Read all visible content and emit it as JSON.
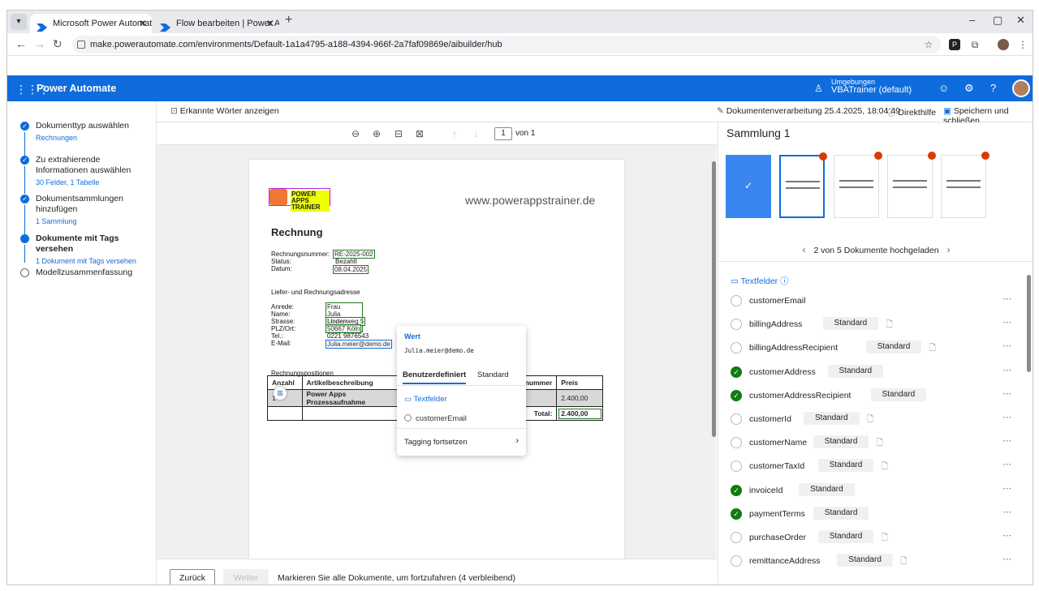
{
  "browser": {
    "tabs": [
      {
        "label": "Microsoft Power Automate | KI"
      },
      {
        "label": "Flow bearbeiten | Power Automate"
      }
    ],
    "new_tab": "+",
    "url": "make.powerautomate.com/environments/Default-1a1a4795-a188-4394-966f-2a7faf09869e/aibuilder/hub",
    "icons": [
      "chevron-down-icon",
      "back-icon",
      "forward-icon",
      "reload-icon",
      "star-icon",
      "extension-icon",
      "profile-icon",
      "menu-icon"
    ]
  },
  "app": {
    "name": "Power Automate",
    "env_label": "Umgebungen",
    "env_name": "VBATrainer (default)",
    "header_icons": [
      "waffle-icon",
      "environment-icon",
      "smiley-icon",
      "settings-icon",
      "help-icon"
    ],
    "brand_color": "#0f6cdc"
  },
  "steps": [
    {
      "title": "Dokumenttyp auswählen",
      "sub": "Rechnungen",
      "state": "done"
    },
    {
      "title": "Zu extrahierende Informationen auswählen",
      "sub": "30 Felder, 1 Tabelle",
      "state": "done"
    },
    {
      "title": "Dokumentsammlungen hinzufügen",
      "sub": "1 Sammlung",
      "state": "done"
    },
    {
      "title": "Dokumente mit Tags versehen",
      "sub": "1 Dokument mit Tags versehen",
      "state": "current"
    },
    {
      "title": "Modellzusammenfassung",
      "sub": "",
      "state": "todo"
    }
  ],
  "toolbar": {
    "show_words": "Erkannte Wörter anzeigen",
    "processing": "Dokumentenverarbeitung 25.4.2025, 18:04:49",
    "help": "Direkthilfe",
    "save": "Speichern und schließen"
  },
  "viewer": {
    "page_num": "1",
    "page_of": "von 1"
  },
  "document": {
    "logo_text": "POWER APPS TRAINER",
    "site": "www.powerappstrainer.de",
    "title": "Rechnung",
    "lbl_nr": "Rechnungsnummer:",
    "val_nr": "RE-2025-002",
    "lbl_status": "Status:",
    "val_status": "Bezahlt",
    "lbl_datum": "Datum:",
    "val_datum": "08.04.2025",
    "addr_head": "Liefer- und Rechnungsadresse",
    "lbl_anrede": "Anrede:",
    "val_anrede": "Frau",
    "lbl_name": "Name:",
    "val_name": "Julia Meiner",
    "lbl_strasse": "Strasse:",
    "val_strasse": "Lindenweg 5",
    "lbl_plz": "PLZ/Ort:",
    "val_plz": "50667 Köln",
    "lbl_tel": "Tel.:",
    "val_tel": "0221 9876543",
    "lbl_mail": "E-Mail:",
    "val_mail": "Julia.meier@demo.de",
    "pos_head": "Rechnungspositionen",
    "col1": "Anzahl",
    "col2": "Artikelbeschreibung",
    "col3": "Artikelnummer",
    "col4": "Preis",
    "row1_desc": "Power Apps Prozessaufnahme",
    "row1_price": "2.400,00",
    "total_lbl": "Total:",
    "total_val": "2.400,00"
  },
  "popup": {
    "wert": "Wert",
    "value": "Julia.meier@demo.de",
    "tab_custom": "Benutzerdefiniert",
    "tab_standard": "Standard",
    "textfelder": "Textfelder",
    "field": "customerEmail",
    "continue": "Tagging fortsetzen"
  },
  "right": {
    "title": "Sammlung 1",
    "pager": "2 von 5 Dokumente hochgeladen",
    "fields_head": "Textfelder",
    "badge": "Standard",
    "fields": [
      {
        "name": "customerEmail",
        "done": false,
        "badge": false,
        "doc": false
      },
      {
        "name": "billingAddress",
        "done": false,
        "badge": true,
        "doc": true
      },
      {
        "name": "billingAddressRecipient",
        "done": false,
        "badge": true,
        "doc": true
      },
      {
        "name": "customerAddress",
        "done": true,
        "badge": true,
        "doc": false
      },
      {
        "name": "customerAddressRecipient",
        "done": true,
        "badge": true,
        "doc": false
      },
      {
        "name": "customerId",
        "done": false,
        "badge": true,
        "doc": true
      },
      {
        "name": "customerName",
        "done": false,
        "badge": true,
        "doc": true
      },
      {
        "name": "customerTaxId",
        "done": false,
        "badge": true,
        "doc": true
      },
      {
        "name": "invoiceId",
        "done": true,
        "badge": true,
        "doc": false
      },
      {
        "name": "paymentTerms",
        "done": true,
        "badge": true,
        "doc": false
      },
      {
        "name": "purchaseOrder",
        "done": false,
        "badge": true,
        "doc": true
      },
      {
        "name": "remittanceAddress",
        "done": false,
        "badge": true,
        "doc": true
      }
    ]
  },
  "footer": {
    "back": "Zurück",
    "next": "Weiter",
    "hint": "Markieren Sie alle Dokumente, um fortzufahren (4 verbleibend)"
  }
}
